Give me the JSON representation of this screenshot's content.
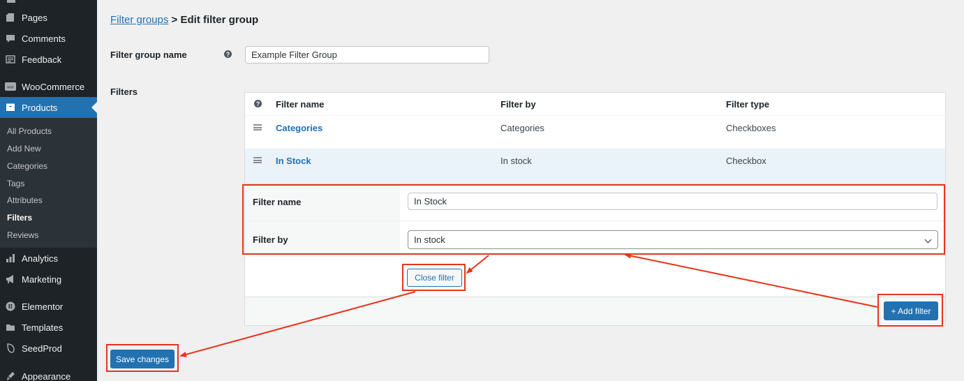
{
  "sidebar": {
    "menu": [
      {
        "label": "Pages",
        "icon": "pages-icon"
      },
      {
        "label": "Comments",
        "icon": "comments-icon"
      },
      {
        "label": "Feedback",
        "icon": "feedback-icon"
      },
      {
        "label": "WooCommerce",
        "icon": "woocommerce-icon"
      },
      {
        "label": "Products",
        "icon": "products-icon",
        "active": true
      },
      {
        "label": "Analytics",
        "icon": "analytics-icon"
      },
      {
        "label": "Marketing",
        "icon": "marketing-icon"
      },
      {
        "label": "Elementor",
        "icon": "elementor-icon"
      },
      {
        "label": "Templates",
        "icon": "templates-icon"
      },
      {
        "label": "SeedProd",
        "icon": "seedprod-icon"
      },
      {
        "label": "Appearance",
        "icon": "appearance-icon"
      }
    ],
    "submenu": [
      "All Products",
      "Add New",
      "Categories",
      "Tags",
      "Attributes",
      "Filters",
      "Reviews"
    ],
    "current_submenu": "Filters"
  },
  "breadcrumb": {
    "link": "Filter groups",
    "separator": ">",
    "current": "Edit filter group"
  },
  "group_name": {
    "label": "Filter group name",
    "value": "Example Filter Group"
  },
  "filters": {
    "label": "Filters",
    "columns": [
      "Filter name",
      "Filter by",
      "Filter type"
    ],
    "rows": [
      {
        "name": "Categories",
        "by": "Categories",
        "type": "Checkboxes"
      },
      {
        "name": "In Stock",
        "by": "In stock",
        "type": "Checkbox"
      }
    ],
    "edit": {
      "name_label": "Filter name",
      "name_value": "In Stock",
      "by_label": "Filter by",
      "by_value": "In stock"
    },
    "close_button": "Close filter",
    "add_button": "+ Add filter"
  },
  "save_button": "Save changes",
  "colors": {
    "accent": "#2271b1",
    "sidebar": "#1d2327",
    "highlight": "#e8341c"
  }
}
